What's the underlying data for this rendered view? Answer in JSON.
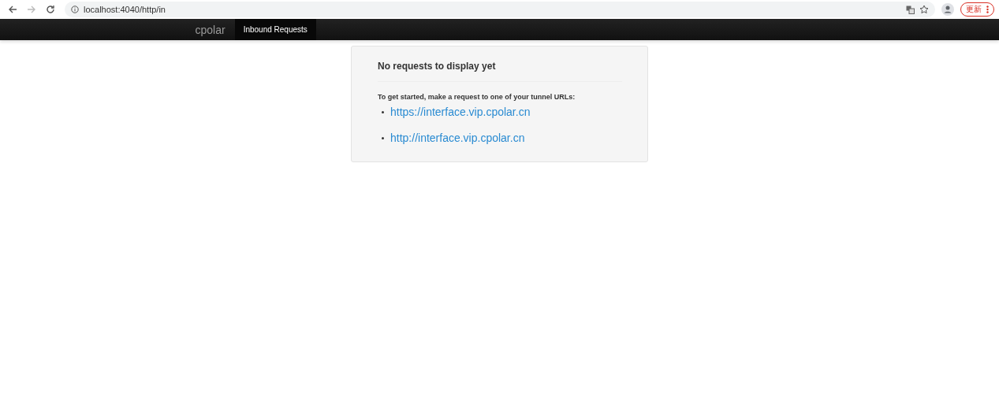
{
  "browser": {
    "url": "localhost:4040/http/in",
    "update_button": "更新"
  },
  "navbar": {
    "brand": "cpolar",
    "tabs": [
      {
        "label": "Inbound Requests",
        "selected": true
      }
    ]
  },
  "panel": {
    "title": "No requests to display yet",
    "intro": "To get started, make a request to one of your tunnel URLs:",
    "links": [
      "https://interface.vip.cpolar.cn",
      "http://interface.vip.cpolar.cn"
    ]
  }
}
